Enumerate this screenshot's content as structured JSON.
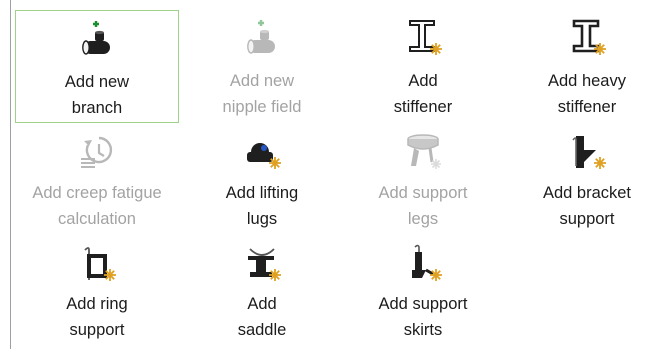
{
  "colors": {
    "selected_border": "#9fd38a",
    "text": "#1c1c1c",
    "text_disabled": "#a3a3a3",
    "accent_plus": "#1a8f2f",
    "accent_sun": "#e0a021",
    "icon_dark": "#1f1f1f",
    "icon_disabled": "#b8b8b8"
  },
  "items": [
    {
      "line1": "Add new",
      "line2": "branch",
      "icon": "pipe-branch-icon",
      "enabled": true,
      "selected": true
    },
    {
      "line1": "Add new",
      "line2": "nipple field",
      "icon": "nipple-field-icon",
      "enabled": false,
      "selected": false
    },
    {
      "line1": "Add",
      "line2": "stiffener",
      "icon": "i-beam-icon",
      "enabled": true,
      "selected": false
    },
    {
      "line1": "Add heavy",
      "line2": "stiffener",
      "icon": "i-beam-heavy-icon",
      "enabled": true,
      "selected": false
    },
    {
      "line1": "Add creep fatigue",
      "line2": "calculation",
      "icon": "creep-fatigue-icon",
      "enabled": false,
      "selected": false
    },
    {
      "line1": "Add lifting",
      "line2": "lugs",
      "icon": "lifting-lug-icon",
      "enabled": true,
      "selected": false
    },
    {
      "line1": "Add support",
      "line2": "legs",
      "icon": "support-legs-icon",
      "enabled": false,
      "selected": false
    },
    {
      "line1": "Add bracket",
      "line2": "support",
      "icon": "bracket-support-icon",
      "enabled": true,
      "selected": false
    },
    {
      "line1": "Add ring",
      "line2": "support",
      "icon": "ring-support-icon",
      "enabled": true,
      "selected": false
    },
    {
      "line1": "Add",
      "line2": "saddle",
      "icon": "saddle-icon",
      "enabled": true,
      "selected": false
    },
    {
      "line1": "Add support",
      "line2": "skirts",
      "icon": "support-skirt-icon",
      "enabled": true,
      "selected": false
    }
  ]
}
